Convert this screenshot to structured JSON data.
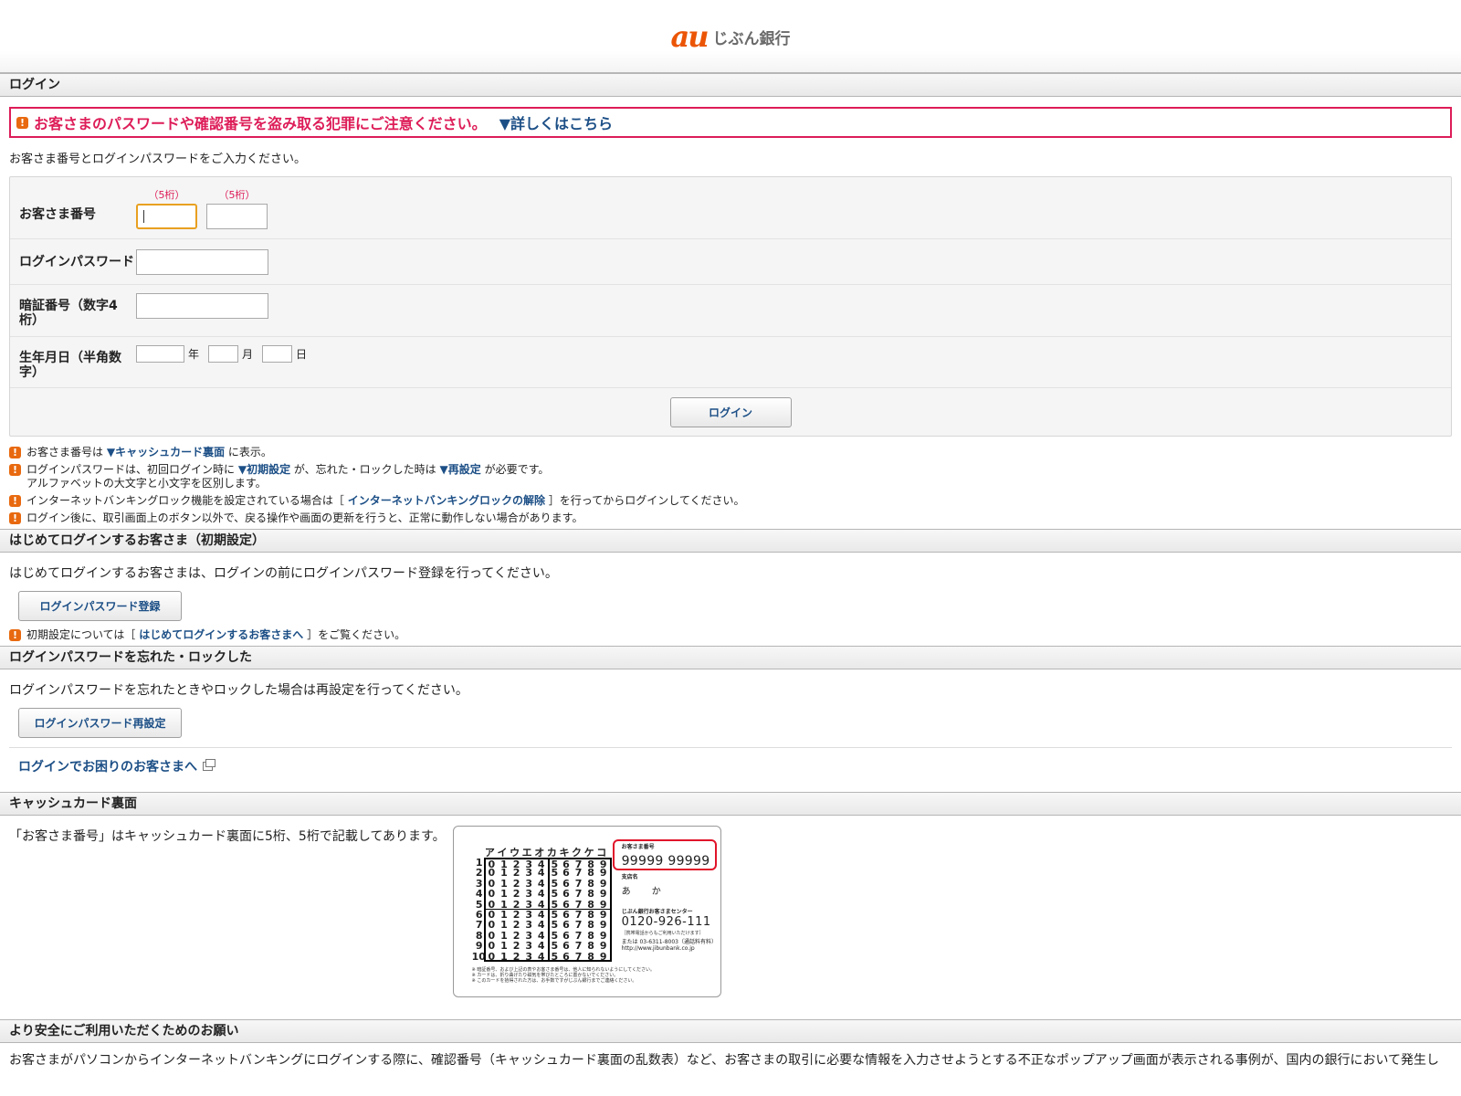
{
  "header": {
    "logo_mark": "au",
    "logo_text": "じぶん銀行"
  },
  "login": {
    "section_title": "ログイン",
    "alert_text": "お客さまのパスワードや確認番号を盗み取る犯罪にご注意ください。",
    "alert_link": "▼詳しくはこちら",
    "intro": "お客さま番号とログインパスワードをご入力ください。",
    "customer_label": "お客さま番号",
    "digit_hint_1": "（5桁）",
    "digit_hint_2": "（5桁）",
    "password_label": "ログインパスワード",
    "pin_label": "暗証番号（数字4桁）",
    "birth_label": "生年月日（半角数字）",
    "year_unit": "年",
    "month_unit": "月",
    "day_unit": "日",
    "submit": "ログイン"
  },
  "notes": {
    "n1_a": "お客さま番号は",
    "n1_link": "▼キャッシュカード裏面",
    "n1_b": "に表示。",
    "n2_a": "ログインパスワードは、初回ログイン時に",
    "n2_link1": "▼初期設定",
    "n2_b": "が、忘れた・ロックした時は",
    "n2_link2": "▼再設定",
    "n2_c": "が必要です。",
    "n2_sub": "アルファベットの大文字と小文字を区別します。",
    "n3_a": "インターネットバンキングロック機能を設定されている場合は［",
    "n3_link": "インターネットバンキングロックの解除",
    "n3_b": "］を行ってからログインしてください。",
    "n4": "ログイン後に、取引画面上のボタン以外で、戻る操作や画面の更新を行うと、正常に動作しない場合があります。"
  },
  "first_login": {
    "section_title": "はじめてログインするお客さま（初期設定）",
    "text": "はじめてログインするお客さまは、ログインの前にログインパスワード登録を行ってください。",
    "button": "ログインパスワード登録",
    "note_a": "初期設定については［",
    "note_link": "はじめてログインするお客さまへ",
    "note_b": "］をご覧ください。"
  },
  "forgot": {
    "section_title": "ログインパスワードを忘れた・ロックした",
    "text": "ログインパスワードを忘れたときやロックした場合は再設定を行ってください。",
    "button": "ログインパスワード再設定",
    "help_link": "ログインでお困りのお客さまへ"
  },
  "card": {
    "section_title": "キャッシュカード裏面",
    "desc": "「お客さま番号」はキャッシュカード裏面に5桁、5桁で記載してあります。",
    "grid_head": [
      "ア",
      "イ",
      "ウ",
      "エ",
      "オ",
      "カ",
      "キ",
      "ク",
      "ケ",
      "コ"
    ],
    "grid_rows": [
      "1",
      "2",
      "3",
      "4",
      "5",
      "6",
      "7",
      "8",
      "9",
      "10"
    ],
    "grid_digits": [
      "0",
      "1",
      "2",
      "3",
      "4",
      "5",
      "6",
      "7",
      "8",
      "9"
    ],
    "foot_1": "※ 暗証番号、および上記の表やお客さま番号は、他人に知られないようにしてください。",
    "foot_2": "※ カードは、折り曲げたり磁気を帯びたところに置かないでください。",
    "foot_3": "※ このカードを拾得された方は、お手数ですがじぶん銀行までご連絡ください。",
    "num_label": "お客さま番号",
    "num_value": "99999  99999",
    "branch_label": "支店名",
    "branch_name": "あ か",
    "center_name": "じぶん銀行お客さまセンター",
    "center_tel": "0120-926-111",
    "center_note": "［携帯電話からもご利用いただけます］",
    "center_alt": "または 03-6311-8003（通話料有料）",
    "center_url": "http://www.jibunbank.co.jp"
  },
  "safety": {
    "section_title": "より安全にご利用いただくためのお願い",
    "text": "お客さまがパソコンからインターネットバンキングにログインする際に、確認番号（キャッシュカード裏面の乱数表）など、お客さまの取引に必要な情報を入力させようとする不正なポップアップ画面が表示される事例が、国内の銀行において発生し"
  },
  "colors": {
    "alert": "#dd1c58",
    "link": "#1c4f86",
    "warn_icon": "#e8690f",
    "brand": "#eb5505"
  }
}
